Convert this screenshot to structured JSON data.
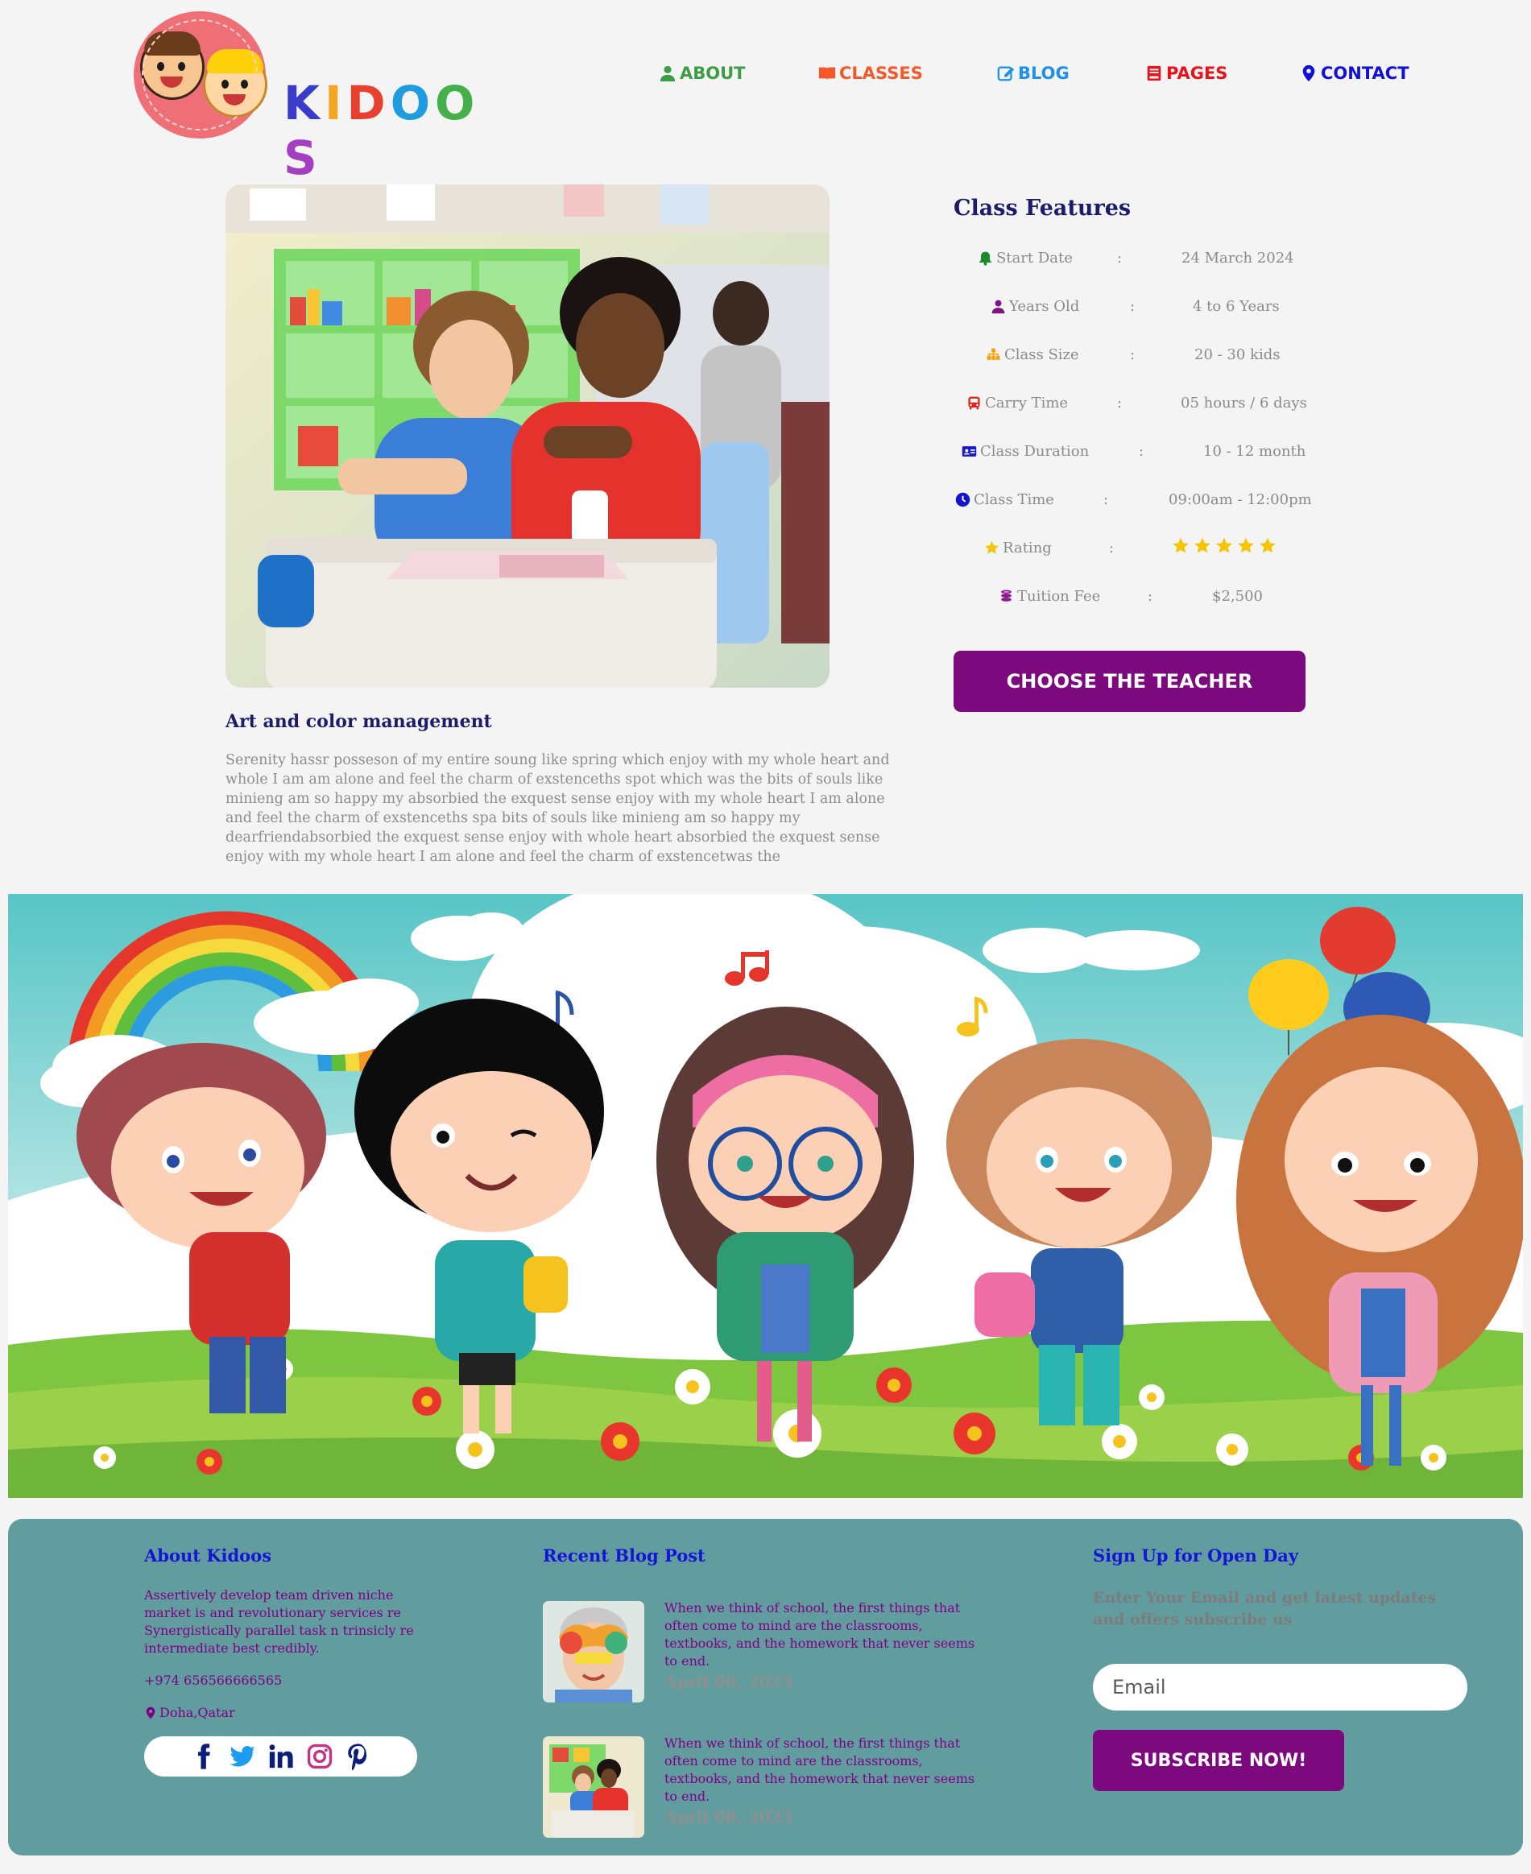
{
  "brand": {
    "name_letters": [
      "K",
      "I",
      "D",
      "O",
      "O",
      "S"
    ],
    "letter_colors": [
      "#3a3acb",
      "#f6a623",
      "#e8402f",
      "#1f9be0",
      "#43b04a",
      "#a43fc1"
    ]
  },
  "nav": {
    "items": [
      {
        "label": "ABOUT",
        "icon": "user-icon",
        "color": "#3c9d45"
      },
      {
        "label": "CLASSES",
        "icon": "book-icon",
        "color": "#f2582a"
      },
      {
        "label": "BLOG",
        "icon": "edit-icon",
        "color": "#1e90e8"
      },
      {
        "label": "PAGES",
        "icon": "book-bookmark-icon",
        "color": "#e8121a"
      },
      {
        "label": "CONTACT",
        "icon": "location-pin-icon",
        "color": "#1010d8"
      }
    ]
  },
  "class": {
    "title": "Art and color management",
    "description": "Serenity hassr posseson of my entire soung like spring which enjoy with my whole heart and whole I am am alone and feel the charm of exstenceths spot which was the bits of souls like minieng am so happy my absorbied the exquest sense enjoy with my whole heart I am alone and feel the charm of exstenceths spa bits of souls like minieng am so happy my dearfriendabsorbied the exquest sense enjoy with whole heart absorbied the exquest sense enjoy with my whole heart I am alone and feel the charm of exstencetwas the"
  },
  "features": {
    "title": "Class Features",
    "separator": ":",
    "rows": [
      {
        "label": "Start Date",
        "icon": "bell-icon",
        "icon_color": "#1a8a2a",
        "value": "24 March 2024"
      },
      {
        "label": "Years Old",
        "icon": "user-icon",
        "icon_color": "#7b1582",
        "value": "4 to 6 Years"
      },
      {
        "label": "Class Size",
        "icon": "sitemap-icon",
        "icon_color": "#f5a300",
        "value": "20 - 30 kids"
      },
      {
        "label": "Carry Time",
        "icon": "bus-icon",
        "icon_color": "#e2241b",
        "value": "05 hours / 6 days"
      },
      {
        "label": "Class Duration",
        "icon": "id-card-icon",
        "icon_color": "#1a1ac8",
        "value": "10 - 12 month"
      },
      {
        "label": "Class Time",
        "icon": "clock-icon",
        "icon_color": "#1313d0",
        "value": "09:00am - 12:00pm"
      },
      {
        "label": "Rating",
        "icon": "star-icon",
        "icon_color": "#f5c500",
        "value": "",
        "stars": 5
      },
      {
        "label": "Tuition Fee",
        "icon": "coins-icon",
        "icon_color": "#8b1a8f",
        "value": "$2,500"
      }
    ],
    "button_label": "CHOOSE THE TEACHER"
  },
  "footer": {
    "about": {
      "heading": "About Kidoos",
      "text": "Assertively develop team driven niche market is and revolutionary services re Synergistically parallel task n trinsicly re intermediate best credibly.",
      "phone": "+974 656566666565",
      "location": "Doha,Qatar",
      "social": [
        "facebook-icon",
        "twitter-icon",
        "linkedin-icon",
        "instagram-icon",
        "pinterest-icon"
      ]
    },
    "blog": {
      "heading": "Recent Blog Post",
      "posts": [
        {
          "text": "When we think of school, the first things that often come to mind are the classrooms, textbooks, and the homework that never seems to end.",
          "date": "April 08, 2025"
        },
        {
          "text": "When we think of school, the first things that often come to mind are the classrooms, textbooks, and the homework that never seems to end.",
          "date": "April 08, 2025"
        }
      ]
    },
    "signup": {
      "heading": "Sign Up for Open Day",
      "description": "Enter Your Email and get latest updates and offers subscribe us",
      "email_placeholder": "Email",
      "button_label": "SUBSCRIBE NOW!"
    }
  },
  "colors": {
    "page_bg": "#f4f4f4",
    "accent": "#7c0a7e",
    "heading": "#1c1c6b",
    "footer_bg": "#619c9e"
  }
}
